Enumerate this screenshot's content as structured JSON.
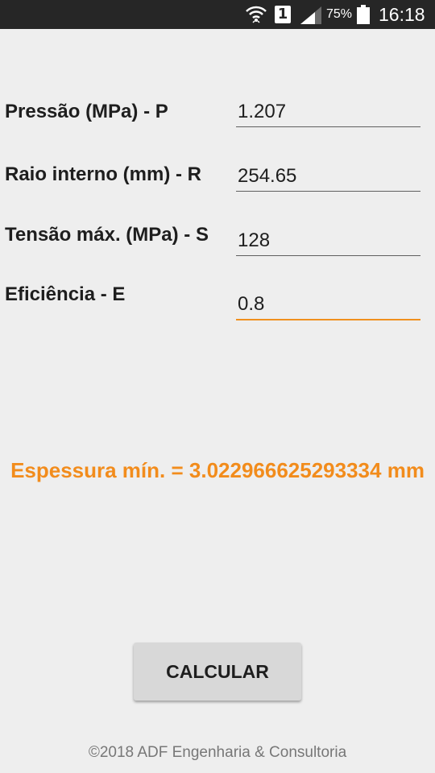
{
  "status_bar": {
    "battery_percent": "75%",
    "sim_slot": "1",
    "time": "16:18",
    "icons": [
      "wifi-icon",
      "sim-icon",
      "signal-icon",
      "battery-icon"
    ]
  },
  "form": {
    "fields": [
      {
        "label": "Pressão (MPa) - P",
        "value": "1.207"
      },
      {
        "label": "Raio interno (mm) - R",
        "value": "254.65"
      },
      {
        "label": "Tensão máx. (MPa) - S",
        "value": "128"
      },
      {
        "label": "Eficiência - E",
        "value": "0.8",
        "focused": true
      }
    ]
  },
  "result": {
    "text": "Espessura mín. = 3.022966625293334 mm"
  },
  "actions": {
    "calculate_label": "CALCULAR"
  },
  "footer": {
    "text": "©2018 ADF Engenharia & Consultoria"
  },
  "colors": {
    "accent": "#f28c1c",
    "status_bar": "#262626",
    "background": "#eeeeee",
    "button": "#d8d8d8"
  }
}
